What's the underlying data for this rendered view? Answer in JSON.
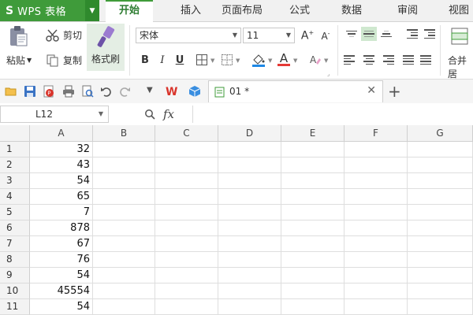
{
  "app": {
    "logo": "S",
    "name": "WPS 表格"
  },
  "tabs": [
    "开始",
    "插入",
    "页面布局",
    "公式",
    "数据",
    "审阅",
    "视图"
  ],
  "ribbon": {
    "paste": "粘贴",
    "cut": "剪切",
    "copy": "复制",
    "format_painter": "格式刷",
    "font_name": "宋体",
    "font_size": "11",
    "bold": "B",
    "italic": "I",
    "underline": "U",
    "merge": "合并居"
  },
  "document": {
    "tab_name": "01 *"
  },
  "formula_bar": {
    "name_box": "L12",
    "fx": "fx",
    "value": ""
  },
  "sheet": {
    "columns": [
      "A",
      "B",
      "C",
      "D",
      "E",
      "F",
      "G"
    ],
    "rows": [
      "1",
      "2",
      "3",
      "4",
      "5",
      "6",
      "7",
      "8",
      "9",
      "10",
      "11"
    ],
    "col_a_values": [
      "32",
      "43",
      "54",
      "65",
      "7",
      "878",
      "67",
      "76",
      "54",
      "45554",
      "54"
    ]
  },
  "colors": {
    "brand": "#3f9b3a",
    "active_tab": "#2e7d32",
    "selected_align": "#cfe8cf"
  }
}
